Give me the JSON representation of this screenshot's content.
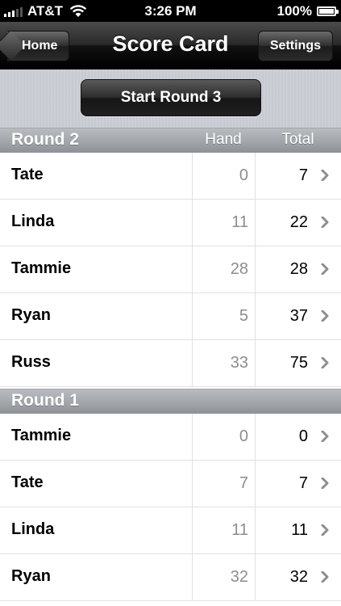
{
  "status_bar": {
    "carrier": "AT&T",
    "time": "3:26 PM",
    "battery": "100%"
  },
  "nav": {
    "title": "Score Card",
    "back_label": "Home",
    "settings_label": "Settings"
  },
  "toolbar": {
    "start_label": "Start Round 3"
  },
  "sections": [
    {
      "title": "Round 2",
      "col_hand": "Hand",
      "col_total": "Total",
      "rows": [
        {
          "name": "Tate",
          "hand": "0",
          "total": "7"
        },
        {
          "name": "Linda",
          "hand": "11",
          "total": "22"
        },
        {
          "name": "Tammie",
          "hand": "28",
          "total": "28"
        },
        {
          "name": "Ryan",
          "hand": "5",
          "total": "37"
        },
        {
          "name": "Russ",
          "hand": "33",
          "total": "75"
        }
      ]
    },
    {
      "title": "Round 1",
      "rows": [
        {
          "name": "Tammie",
          "hand": "0",
          "total": "0"
        },
        {
          "name": "Tate",
          "hand": "7",
          "total": "7"
        },
        {
          "name": "Linda",
          "hand": "11",
          "total": "11"
        },
        {
          "name": "Ryan",
          "hand": "32",
          "total": "32"
        }
      ]
    }
  ],
  "icons": {
    "signal": "signal-icon",
    "wifi": "wifi-icon",
    "battery": "battery-icon",
    "chevron": "chevron-right-icon"
  },
  "colors": {
    "nav_background": "#1c1c1c",
    "hand_text": "#8d8d8d",
    "chevron": "#8e8e8e"
  }
}
